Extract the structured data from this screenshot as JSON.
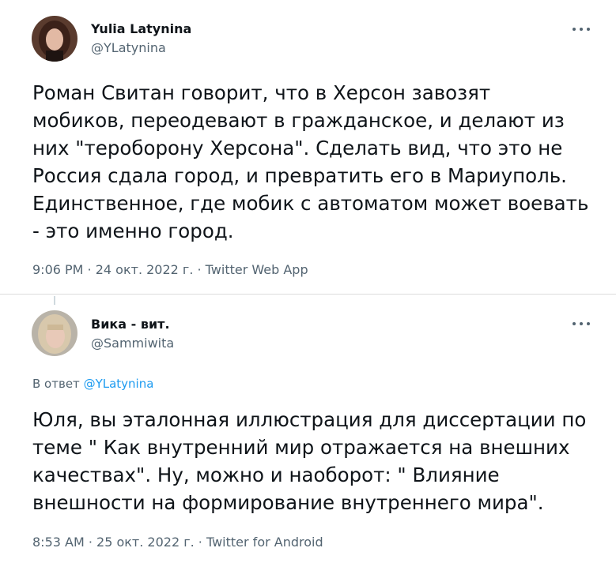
{
  "tweets": [
    {
      "author_name": "Yulia Latynina",
      "author_handle": "@YLatynina",
      "text": "Роман Свитан говорит, что в Херсон завозят\nмобиков, переодевают в гражданское, и делают из\nних \"тероборону Херсона\". Сделать вид, что это не\nРоссия сдала город, и превратить его в Мариуполь.\nЕдинственное, где мобик с автоматом может воевать\n- это именно город.",
      "meta": "9:06 PM · 24 окт. 2022 г. · Twitter Web App",
      "avatar_icon": "user-avatar-dark-hair"
    },
    {
      "author_name": "Вика - вит.",
      "author_handle": "@Sammiwita",
      "reply_prefix": "В ответ",
      "reply_mention": "@YLatynina",
      "text": "Юля, вы эталонная иллюстрация для диссертации по\nтеме \" Как внутренний мир отражается на внешних\nкачествах\". Ну, можно и наоборот: \" Влияние\nвнешности на формирование внутреннего мира\".",
      "meta": "8:53 AM · 25 окт. 2022 г. · Twitter for Android",
      "avatar_icon": "user-avatar-light-hair"
    }
  ],
  "colors": {
    "text_primary": "#0f1419",
    "text_secondary": "#536471",
    "accent": "#1d9bf0",
    "divider": "#dcdcdc"
  },
  "icons": [
    "more-options-icon"
  ]
}
